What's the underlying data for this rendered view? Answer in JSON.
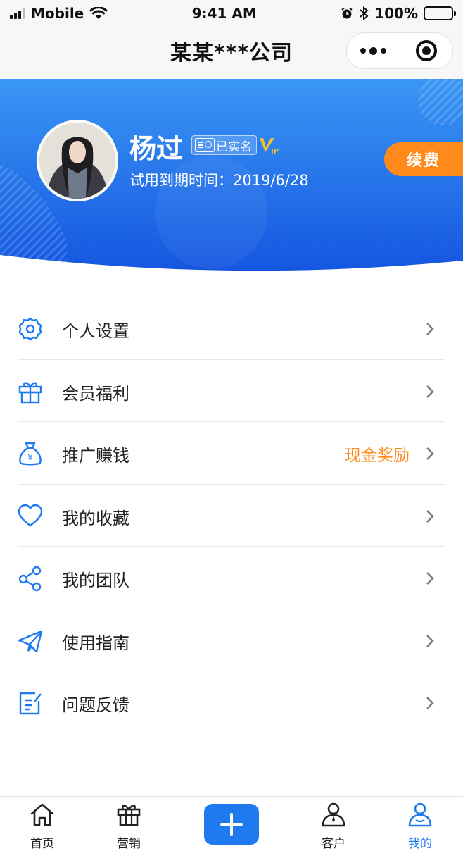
{
  "status_bar": {
    "carrier": "Mobile",
    "time": "9:41 AM",
    "battery_percent": "100%"
  },
  "nav": {
    "title": "某某***公司"
  },
  "profile": {
    "name": "杨过",
    "verified_label": "已实名",
    "vip_label": "VIP",
    "trial_text": "试用到期时间：2019/6/28",
    "renew_label": "续费"
  },
  "menu": {
    "items": [
      {
        "label": "个人设置",
        "icon": "gear-icon",
        "extra": ""
      },
      {
        "label": "会员福利",
        "icon": "gift-icon",
        "extra": ""
      },
      {
        "label": "推广赚钱",
        "icon": "money-bag-icon",
        "extra": "现金奖励"
      },
      {
        "label": "我的收藏",
        "icon": "heart-icon",
        "extra": ""
      },
      {
        "label": "我的团队",
        "icon": "share-nodes-icon",
        "extra": ""
      },
      {
        "label": "使用指南",
        "icon": "paper-plane-icon",
        "extra": ""
      },
      {
        "label": "问题反馈",
        "icon": "feedback-edit-icon",
        "extra": ""
      }
    ]
  },
  "tabs": [
    {
      "label": "首页",
      "icon": "home-icon"
    },
    {
      "label": "营销",
      "icon": "gift-icon"
    },
    {
      "label": "",
      "icon": "plus-icon"
    },
    {
      "label": "客户",
      "icon": "customer-icon"
    },
    {
      "label": "我的",
      "icon": "user-icon",
      "active": true
    }
  ],
  "colors": {
    "primary": "#1f7af0",
    "accent": "#ff8a1c",
    "text": "#222222"
  }
}
